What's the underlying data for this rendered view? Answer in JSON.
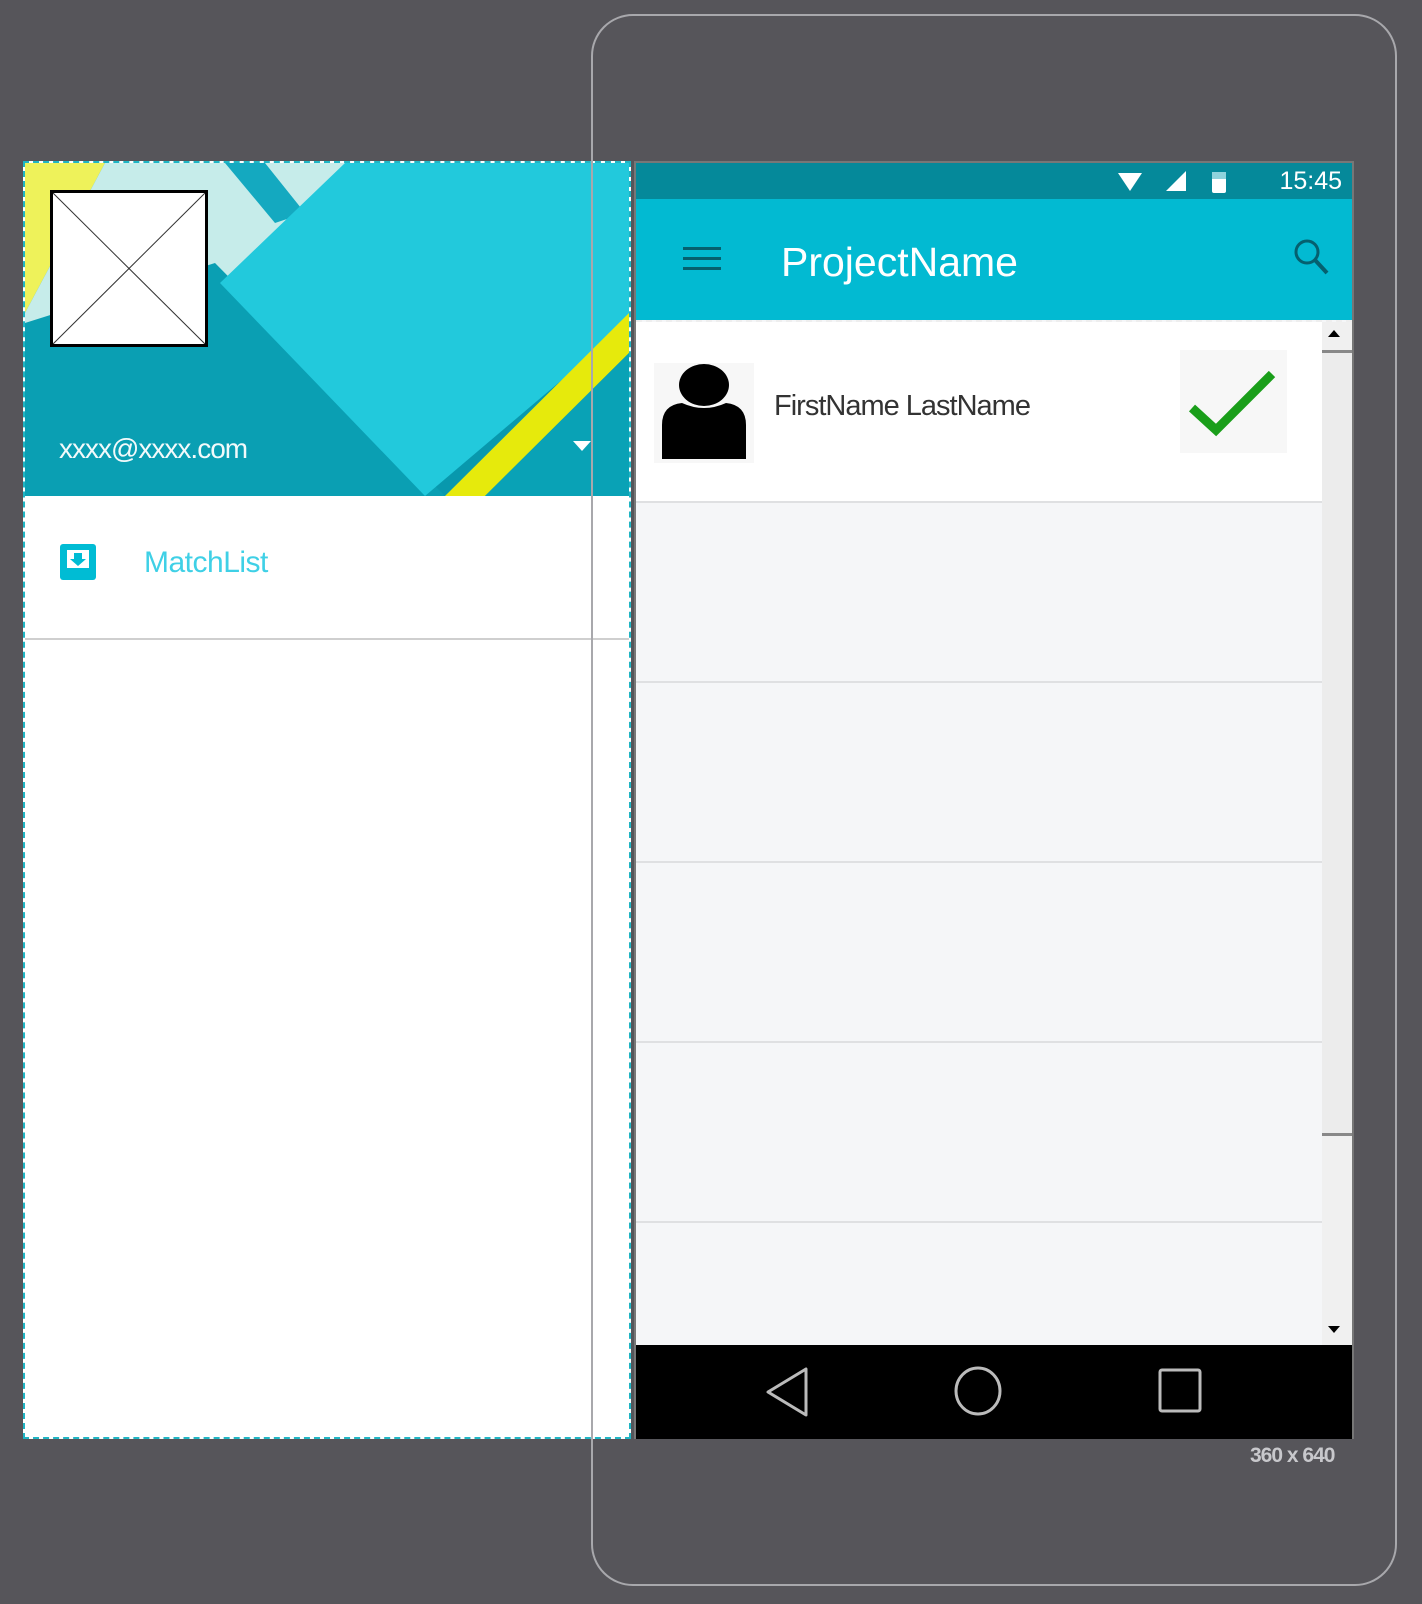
{
  "drawer": {
    "email": "xxxx@xxxx.com",
    "items": [
      {
        "label": "MatchList",
        "icon": "inbox-download-icon"
      }
    ]
  },
  "status_bar": {
    "time": "15:45",
    "icons": [
      "wifi-icon",
      "signal-icon",
      "battery-icon"
    ]
  },
  "app_bar": {
    "title": "ProjectName",
    "menu_icon": "hamburger-icon",
    "action_icon": "search-icon"
  },
  "list": {
    "items": [
      {
        "name": "FirstName LastName",
        "avatar": "person-icon",
        "status_icon": "checkmark-icon",
        "status_color": "#1a9e1a"
      }
    ]
  },
  "nav_bar": {
    "icons": [
      "back-icon",
      "home-icon",
      "recents-icon"
    ]
  },
  "device_size": "360 x 640",
  "colors": {
    "primary": "#02bad2",
    "primary_dark": "#05899a",
    "accent": "#00bcd4"
  }
}
